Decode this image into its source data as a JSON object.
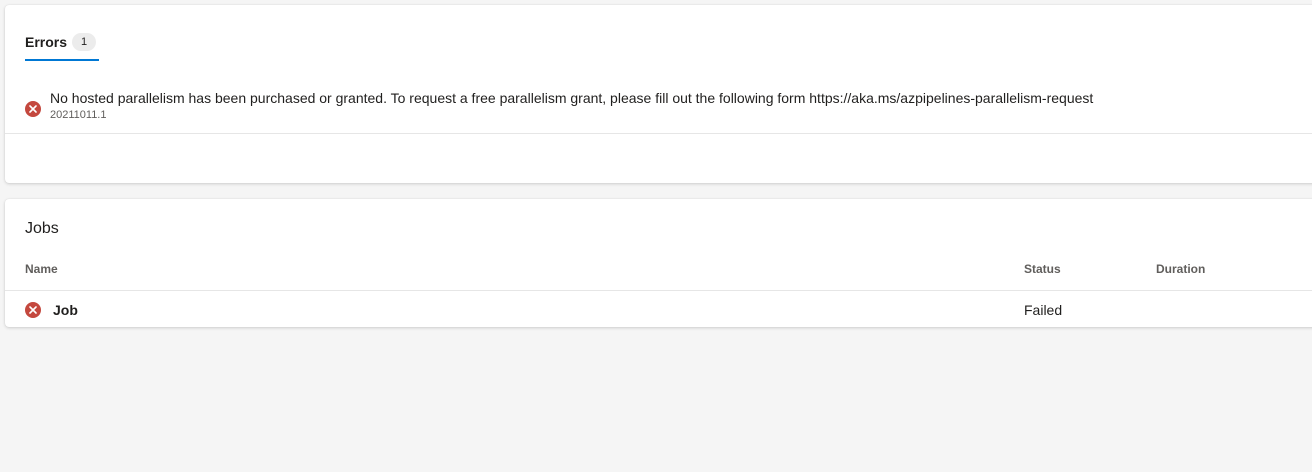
{
  "errors_panel": {
    "tab_label": "Errors",
    "tab_count": "1",
    "error": {
      "icon": "error-circle-icon",
      "message": "No hosted parallelism has been purchased or granted. To request a free parallelism grant, please fill out the following form https://aka.ms/azpipelines-parallelism-request",
      "run_id": "20211011.1"
    }
  },
  "jobs_panel": {
    "title": "Jobs",
    "columns": [
      "Name",
      "Status",
      "Duration"
    ],
    "rows": [
      {
        "icon": "error-circle-icon",
        "name": "Job",
        "status": "Failed",
        "duration": ""
      }
    ]
  },
  "colors": {
    "accent": "#0078d4",
    "error": "#c4483e",
    "page_background": "#f5f5f5"
  }
}
